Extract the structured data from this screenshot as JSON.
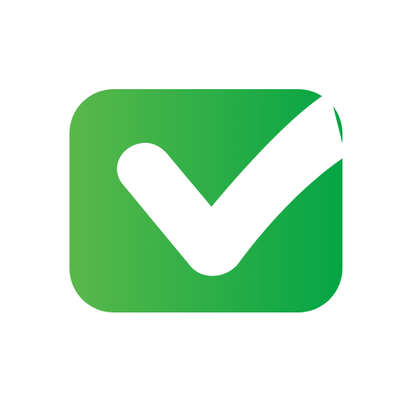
{
  "icon": {
    "name": "checkmark-box-icon",
    "colors": {
      "background": "#ffffff",
      "box_gradient_start": "#5ab84a",
      "box_gradient_end": "#04a545",
      "check_mark": "#ffffff"
    }
  }
}
